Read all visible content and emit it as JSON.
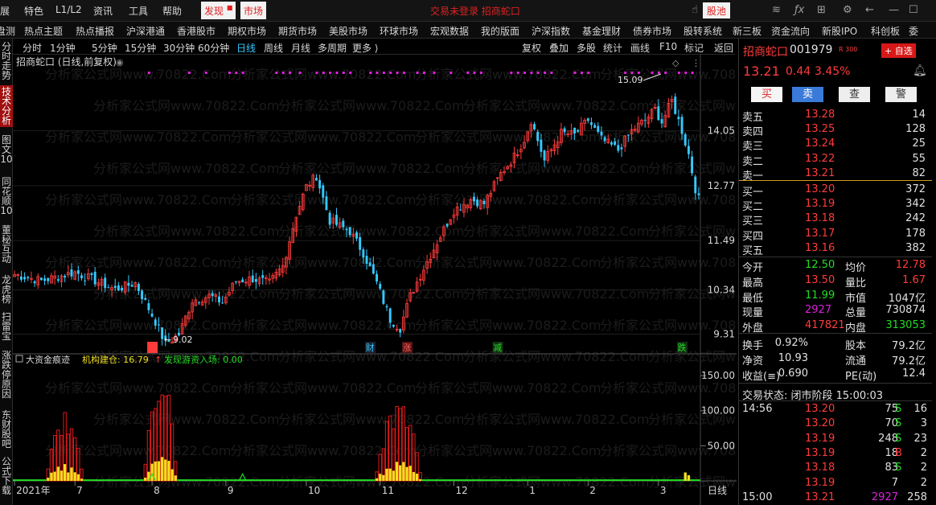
{
  "topbar": {
    "menus": [
      "展",
      "特色",
      "L1/L2",
      "资讯",
      "工具",
      "帮助"
    ],
    "discover": "发现",
    "market": "市场",
    "notice": "交易未登录  招商蛇口",
    "stock_pool": "股池"
  },
  "navbar": [
    "盘测",
    "热点主题",
    "热点播报",
    "沪深港通",
    "香港股市",
    "期权市场",
    "期货市场",
    "美股市场",
    "环球市场",
    "宏观数据",
    "我的版面",
    "沪深指数",
    "基金理财",
    "债券市场",
    "股转系统",
    "新三板",
    "资金流向",
    "新股IPO",
    "科创板",
    "委"
  ],
  "sidebar": [
    "分时走势",
    "技术分析",
    "图文10",
    "同花顺10",
    "董秘互动",
    "龙虎榜",
    "扫雷宝",
    "涨跌停原因",
    "东财股吧",
    "公式下载"
  ],
  "periods": [
    "分时",
    "1分钟",
    "5分钟",
    "15分钟",
    "30分钟",
    "60分钟",
    "日线",
    "周线",
    "月线",
    "多周期",
    "更多 ⟩"
  ],
  "selected_period": "日线",
  "chart_tools": [
    "复权",
    "叠加",
    "多股",
    "统计",
    "画线",
    "F10",
    "标记",
    "返回"
  ],
  "chart_title": "招商蛇口 (日线,前复权)",
  "indicator": {
    "name": "大资金痕迹",
    "inst_label": "机构建仓: 16.79",
    "arrow": "↑",
    "hot_label": "发现游资入场: 0.00"
  },
  "event_labels": {
    "s": "S",
    "cai": "财",
    "zhang": "涨",
    "jian": "减",
    "die": "跌"
  },
  "watermark": "分析家公式网www.70822.Com",
  "annotations": {
    "high": "15.09",
    "low": "9.02"
  },
  "bottom_period": "日线",
  "chart_data": {
    "type": "candlestick",
    "title": "招商蛇口 (日线,前复权)",
    "price_ticks": [
      14.05,
      12.77,
      11.49,
      10.34,
      9.31
    ],
    "ylim": [
      8.85,
      15.45
    ],
    "indicator_ticks": [
      150.0,
      100.0,
      50.0
    ],
    "indicator_ylim": [
      0,
      165
    ],
    "x_labels": [
      "2021年",
      "7",
      "8",
      "9",
      "10",
      "11",
      "12",
      "1",
      "2",
      "3"
    ],
    "x_label_bars": [
      0,
      18,
      41,
      63,
      87,
      109,
      131,
      153,
      171,
      192
    ],
    "n_bars": 205,
    "price_anchors": [
      [
        0,
        10.7
      ],
      [
        8,
        10.55
      ],
      [
        18,
        10.75
      ],
      [
        22,
        10.62
      ],
      [
        30,
        10.35
      ],
      [
        36,
        10.5
      ],
      [
        42,
        9.6
      ],
      [
        45,
        9.08
      ],
      [
        49,
        9.3
      ],
      [
        53,
        10.1
      ],
      [
        58,
        10.2
      ],
      [
        62,
        10.05
      ],
      [
        66,
        10.55
      ],
      [
        71,
        10.6
      ],
      [
        76,
        10.5
      ],
      [
        80,
        10.9
      ],
      [
        84,
        12.1
      ],
      [
        87,
        12.75
      ],
      [
        90,
        13.0
      ],
      [
        94,
        11.95
      ],
      [
        100,
        11.7
      ],
      [
        104,
        11.2
      ],
      [
        108,
        10.5
      ],
      [
        112,
        9.65
      ],
      [
        115,
        9.45
      ],
      [
        118,
        10.2
      ],
      [
        122,
        10.85
      ],
      [
        127,
        11.6
      ],
      [
        131,
        12.2
      ],
      [
        136,
        12.45
      ],
      [
        140,
        12.35
      ],
      [
        145,
        13.05
      ],
      [
        149,
        13.45
      ],
      [
        152,
        13.85
      ],
      [
        154,
        14.3
      ],
      [
        158,
        13.35
      ],
      [
        163,
        14.0
      ],
      [
        167,
        13.95
      ],
      [
        171,
        14.3
      ],
      [
        175,
        13.85
      ],
      [
        180,
        13.6
      ],
      [
        184,
        14.05
      ],
      [
        188,
        14.3
      ],
      [
        191,
        14.55
      ],
      [
        193,
        14.25
      ],
      [
        196,
        14.75
      ],
      [
        199,
        14.05
      ],
      [
        201,
        13.5
      ],
      [
        203,
        12.7
      ],
      [
        204,
        12.45
      ]
    ],
    "indicator_bursts": [
      [
        10,
        20,
        95
      ],
      [
        39,
        48,
        160
      ],
      [
        108,
        121,
        110
      ]
    ],
    "markers": {
      "s": 41,
      "cai": 106,
      "zhang": 117,
      "jian": 144,
      "die": 199,
      "tri": [
        41,
        68
      ]
    }
  },
  "quote": {
    "name": "招商蛇口",
    "code": "001979",
    "tag": "R 300",
    "add_button": "+ 自选",
    "price": "13.21",
    "change": "0.44",
    "pct": "3.45%",
    "buttons": [
      "买",
      "卖",
      "查",
      "警"
    ],
    "asks": [
      [
        "卖五",
        "13.28",
        "14"
      ],
      [
        "卖四",
        "13.25",
        "128"
      ],
      [
        "卖三",
        "13.24",
        "25"
      ],
      [
        "卖二",
        "13.22",
        "55"
      ],
      [
        "卖一",
        "13.21",
        "82"
      ]
    ],
    "bids": [
      [
        "买一",
        "13.20",
        "372"
      ],
      [
        "买二",
        "13.19",
        "342"
      ],
      [
        "买三",
        "13.18",
        "242"
      ],
      [
        "买四",
        "13.17",
        "178"
      ],
      [
        "买五",
        "13.16",
        "382"
      ]
    ],
    "stats": [
      [
        [
          "今开",
          "12.50",
          "green"
        ],
        [
          "均价",
          "12.78",
          "red"
        ]
      ],
      [
        [
          "最高",
          "13.50",
          "red"
        ],
        [
          "量比",
          "1.67",
          "red"
        ]
      ],
      [
        [
          "最低",
          "11.99",
          "green"
        ],
        [
          "市值",
          "1047亿",
          "white"
        ]
      ],
      [
        [
          "现量",
          "2927",
          "purple"
        ],
        [
          "总量",
          "730874",
          "white"
        ]
      ],
      [
        [
          "外盘",
          "417821",
          "red"
        ],
        [
          "内盘",
          "313053",
          "green"
        ]
      ]
    ],
    "stats2": [
      [
        [
          "换手",
          "0.92%"
        ],
        [
          "股本",
          "79.2亿"
        ]
      ],
      [
        [
          "净资",
          "10.93"
        ],
        [
          "流通",
          "79.2亿"
        ]
      ],
      [
        [
          "收益(≡)",
          "0.690"
        ],
        [
          "PE(动)",
          "12.4"
        ]
      ]
    ],
    "trade_status": "交易状态: 闭市阶段 15:00:03",
    "ticks": [
      [
        "14:56",
        "13.20",
        "75",
        "S",
        "16"
      ],
      [
        "",
        "13.20",
        "70",
        "S",
        "3"
      ],
      [
        "",
        "13.19",
        "248",
        "S",
        "23"
      ],
      [
        "",
        "13.19",
        "18",
        "B",
        "2"
      ],
      [
        "",
        "13.18",
        "83",
        "S",
        "2"
      ],
      [
        "",
        "13.19",
        "7",
        "",
        "2"
      ],
      [
        "15:00",
        "13.21",
        "2927",
        "",
        "258"
      ]
    ]
  },
  "colors": {
    "up": "#ff3b3b",
    "down": "#35c9ff",
    "accent": "#35c9ff",
    "volume_red": "#e01818",
    "volume_yellow": "#f0e020",
    "baseline": "#22dd22",
    "magenta": "#e020e0"
  }
}
